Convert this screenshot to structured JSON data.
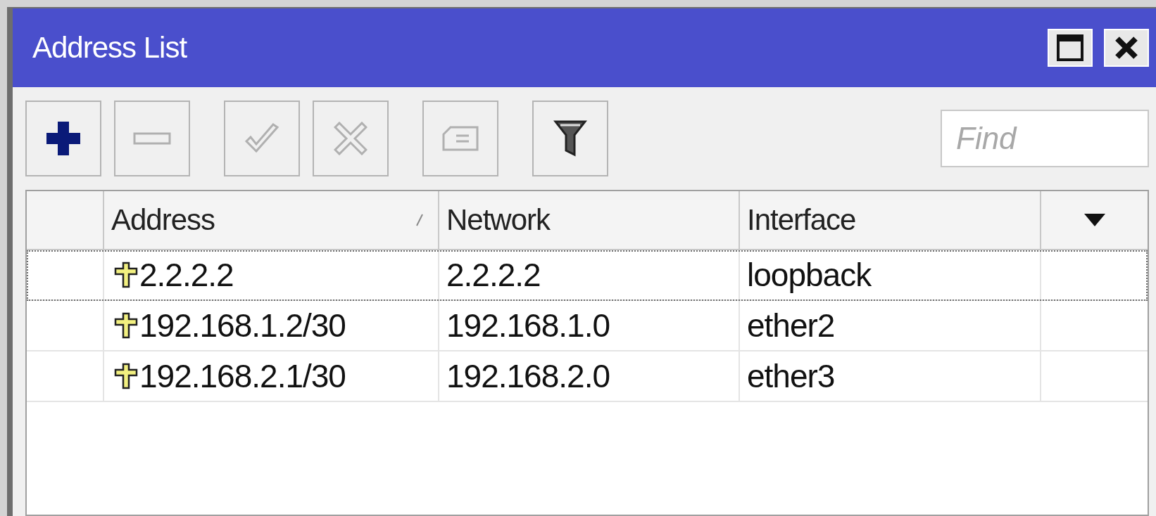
{
  "window": {
    "title": "Address List"
  },
  "toolbar": [
    {
      "kind": "add",
      "disabled": false
    },
    {
      "kind": "remove",
      "disabled": true
    },
    {
      "kind": "enable",
      "disabled": true
    },
    {
      "kind": "disable",
      "disabled": true
    },
    {
      "kind": "comment",
      "disabled": true
    },
    {
      "kind": "filter",
      "disabled": false
    }
  ],
  "search": {
    "placeholder": "Find"
  },
  "table": {
    "columns": [
      {
        "label": "Address",
        "sorted": true
      },
      {
        "label": "Network",
        "sorted": false
      },
      {
        "label": "Interface",
        "sorted": false
      }
    ],
    "rows": [
      {
        "cells": [
          "2.2.2.2",
          "2.2.2.2",
          "loopback"
        ],
        "focused": true
      },
      {
        "cells": [
          "192.168.1.2/30",
          "192.168.1.0",
          "ether2"
        ],
        "focused": false
      },
      {
        "cells": [
          "192.168.2.1/30",
          "192.168.2.0",
          "ether3"
        ],
        "focused": false
      }
    ]
  }
}
